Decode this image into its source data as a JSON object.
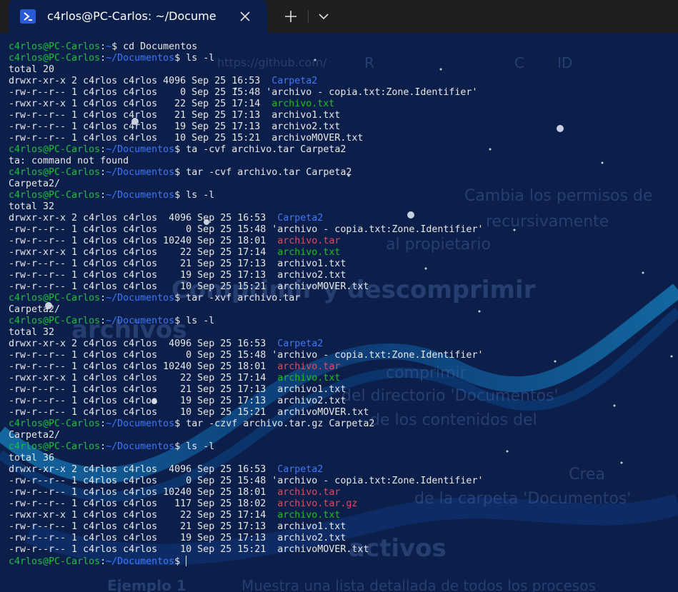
{
  "window": {
    "tab_title": "c4rlos@PC-Carlos: ~/Docume",
    "icons": {
      "tab": "powershell-icon",
      "close": "close-icon",
      "new_tab": "plus-icon",
      "dropdown": "chevron-down-icon"
    }
  },
  "colors": {
    "background": "#0c1f4a",
    "prompt_user": "#19c23a",
    "prompt_path": "#3b78ff",
    "directory": "#3b78ff",
    "archive": "#e74856",
    "executable": "#16c60c",
    "text": "#e8e8e8"
  },
  "background_text": [
    "https://github.com/",
    "R",
    "C",
    "ID",
    "Cambia los permisos de",
    "recursivamente",
    "al propietario",
    "Comprimir y descomprimir",
    "archivos",
    "comprimir",
    "del directorio 'Documentos'",
    "de los contenidos del",
    "Crea",
    "de la carpeta 'Documentos'",
    "activos",
    "Muestra una lista detallada de todos los procesos",
    "Ejemplo 1"
  ],
  "terminal": {
    "lines": [
      [
        {
          "t": "c4rlos@PC-Carlos",
          "c": "p-user"
        },
        {
          "t": ":",
          "c": "c-white"
        },
        {
          "t": "~",
          "c": "p-path"
        },
        {
          "t": "$ cd Documentos",
          "c": "c-white"
        }
      ],
      [
        {
          "t": "c4rlos@PC-Carlos",
          "c": "p-user"
        },
        {
          "t": ":",
          "c": "c-white"
        },
        {
          "t": "~/Documentos",
          "c": "p-path"
        },
        {
          "t": "$ ls -l",
          "c": "c-white"
        }
      ],
      [
        {
          "t": "total 20",
          "c": "c-white"
        }
      ],
      [
        {
          "t": "drwxr-xr-x 2 c4rlos c4rlos 4096 Sep 25 16:53  ",
          "c": "c-white"
        },
        {
          "t": "Carpeta2",
          "c": "c-dir"
        }
      ],
      [
        {
          "t": "-rw-r--r-- 1 c4rlos c4rlos    0 Sep 25 15:48 'archivo - copia.txt:Zone.Identifier'",
          "c": "c-white"
        }
      ],
      [
        {
          "t": "-rwxr-xr-x 1 c4rlos c4rlos   22 Sep 25 17:14  ",
          "c": "c-white"
        },
        {
          "t": "archivo.txt",
          "c": "c-green"
        }
      ],
      [
        {
          "t": "-rw-r--r-- 1 c4rlos c4rlos   21 Sep 25 17:13  archivo1.txt",
          "c": "c-white"
        }
      ],
      [
        {
          "t": "-rw-r--r-- 1 c4rlos c4rlos   19 Sep 25 17:13  archivo2.txt",
          "c": "c-white"
        }
      ],
      [
        {
          "t": "-rw-r--r-- 1 c4rlos c4rlos   10 Sep 25 15:21  archivoMOVER.txt",
          "c": "c-white"
        }
      ],
      [
        {
          "t": "c4rlos@PC-Carlos",
          "c": "p-user"
        },
        {
          "t": ":",
          "c": "c-white"
        },
        {
          "t": "~/Documentos",
          "c": "p-path"
        },
        {
          "t": "$ ta -cvf archivo.tar Carpeta2",
          "c": "c-white"
        }
      ],
      [
        {
          "t": "ta: command not found",
          "c": "c-white"
        }
      ],
      [
        {
          "t": "c4rlos@PC-Carlos",
          "c": "p-user"
        },
        {
          "t": ":",
          "c": "c-white"
        },
        {
          "t": "~/Documentos",
          "c": "p-path"
        },
        {
          "t": "$ tar -cvf archivo.tar Carpeta2",
          "c": "c-white"
        }
      ],
      [
        {
          "t": "Carpeta2/",
          "c": "c-white"
        }
      ],
      [
        {
          "t": "c4rlos@PC-Carlos",
          "c": "p-user"
        },
        {
          "t": ":",
          "c": "c-white"
        },
        {
          "t": "~/Documentos",
          "c": "p-path"
        },
        {
          "t": "$ ls -l",
          "c": "c-white"
        }
      ],
      [
        {
          "t": "total 32",
          "c": "c-white"
        }
      ],
      [
        {
          "t": "drwxr-xr-x 2 c4rlos c4rlos  4096 Sep 25 16:53  ",
          "c": "c-white"
        },
        {
          "t": "Carpeta2",
          "c": "c-dir"
        }
      ],
      [
        {
          "t": "-rw-r--r-- 1 c4rlos c4rlos     0 Sep 25 15:48 'archivo - copia.txt:Zone.Identifier'",
          "c": "c-white"
        }
      ],
      [
        {
          "t": "-rw-r--r-- 1 c4rlos c4rlos 10240 Sep 25 18:01  ",
          "c": "c-white"
        },
        {
          "t": "archivo.tar",
          "c": "c-red"
        }
      ],
      [
        {
          "t": "-rwxr-xr-x 1 c4rlos c4rlos    22 Sep 25 17:14  ",
          "c": "c-white"
        },
        {
          "t": "archivo.txt",
          "c": "c-green"
        }
      ],
      [
        {
          "t": "-rw-r--r-- 1 c4rlos c4rlos    21 Sep 25 17:13  archivo1.txt",
          "c": "c-white"
        }
      ],
      [
        {
          "t": "-rw-r--r-- 1 c4rlos c4rlos    19 Sep 25 17:13  archivo2.txt",
          "c": "c-white"
        }
      ],
      [
        {
          "t": "-rw-r--r-- 1 c4rlos c4rlos    10 Sep 25 15:21  archivoMOVER.txt",
          "c": "c-white"
        }
      ],
      [
        {
          "t": "c4rlos@PC-Carlos",
          "c": "p-user"
        },
        {
          "t": ":",
          "c": "c-white"
        },
        {
          "t": "~/Documentos",
          "c": "p-path"
        },
        {
          "t": "$ tar -xvf archivo.tar",
          "c": "c-white"
        }
      ],
      [
        {
          "t": "Carpeta2/",
          "c": "c-white"
        }
      ],
      [
        {
          "t": "c4rlos@PC-Carlos",
          "c": "p-user"
        },
        {
          "t": ":",
          "c": "c-white"
        },
        {
          "t": "~/Documentos",
          "c": "p-path"
        },
        {
          "t": "$ ls -l",
          "c": "c-white"
        }
      ],
      [
        {
          "t": "total 32",
          "c": "c-white"
        }
      ],
      [
        {
          "t": "drwxr-xr-x 2 c4rlos c4rlos  4096 Sep 25 16:53  ",
          "c": "c-white"
        },
        {
          "t": "Carpeta2",
          "c": "c-dir"
        }
      ],
      [
        {
          "t": "-rw-r--r-- 1 c4rlos c4rlos     0 Sep 25 15:48 'archivo - copia.txt:Zone.Identifier'",
          "c": "c-white"
        }
      ],
      [
        {
          "t": "-rw-r--r-- 1 c4rlos c4rlos 10240 Sep 25 18:01  ",
          "c": "c-white"
        },
        {
          "t": "archivo.tar",
          "c": "c-red"
        }
      ],
      [
        {
          "t": "-rwxr-xr-x 1 c4rlos c4rlos    22 Sep 25 17:14  ",
          "c": "c-white"
        },
        {
          "t": "archivo.txt",
          "c": "c-green"
        }
      ],
      [
        {
          "t": "-rw-r--r-- 1 c4rlos c4rlos    21 Sep 25 17:13  archivo1.txt",
          "c": "c-white"
        }
      ],
      [
        {
          "t": "-rw-r--r-- 1 c4rlos c4rlos    19 Sep 25 17:13  archivo2.txt",
          "c": "c-white"
        }
      ],
      [
        {
          "t": "-rw-r--r-- 1 c4rlos c4rlos    10 Sep 25 15:21  archivoMOVER.txt",
          "c": "c-white"
        }
      ],
      [
        {
          "t": "c4rlos@PC-Carlos",
          "c": "p-user"
        },
        {
          "t": ":",
          "c": "c-white"
        },
        {
          "t": "~/Documentos",
          "c": "p-path"
        },
        {
          "t": "$ tar -czvf archivo.tar.gz Carpeta2",
          "c": "c-white"
        }
      ],
      [
        {
          "t": "Carpeta2/",
          "c": "c-white"
        }
      ],
      [
        {
          "t": "c4rlos@PC-Carlos",
          "c": "p-user"
        },
        {
          "t": ":",
          "c": "c-white"
        },
        {
          "t": "~/Documentos",
          "c": "p-path"
        },
        {
          "t": "$ ls -l",
          "c": "c-white"
        }
      ],
      [
        {
          "t": "total 36",
          "c": "c-white"
        }
      ],
      [
        {
          "t": "drwxr-xr-x 2 c4rlos c4rlos  4096 Sep 25 16:53  ",
          "c": "c-white"
        },
        {
          "t": "Carpeta2",
          "c": "c-dir"
        }
      ],
      [
        {
          "t": "-rw-r--r-- 1 c4rlos c4rlos     0 Sep 25 15:48 'archivo - copia.txt:Zone.Identifier'",
          "c": "c-white"
        }
      ],
      [
        {
          "t": "-rw-r--r-- 1 c4rlos c4rlos 10240 Sep 25 18:01  ",
          "c": "c-white"
        },
        {
          "t": "archivo.tar",
          "c": "c-red"
        }
      ],
      [
        {
          "t": "-rw-r--r-- 1 c4rlos c4rlos   117 Sep 25 18:02  ",
          "c": "c-white"
        },
        {
          "t": "archivo.tar.gz",
          "c": "c-red"
        }
      ],
      [
        {
          "t": "-rwxr-xr-x 1 c4rlos c4rlos    22 Sep 25 17:14  ",
          "c": "c-white"
        },
        {
          "t": "archivo.txt",
          "c": "c-green"
        }
      ],
      [
        {
          "t": "-rw-r--r-- 1 c4rlos c4rlos    21 Sep 25 17:13  archivo1.txt",
          "c": "c-white"
        }
      ],
      [
        {
          "t": "-rw-r--r-- 1 c4rlos c4rlos    19 Sep 25 17:13  archivo2.txt",
          "c": "c-white"
        }
      ],
      [
        {
          "t": "-rw-r--r-- 1 c4rlos c4rlos    10 Sep 25 15:21  archivoMOVER.txt",
          "c": "c-white"
        }
      ],
      [
        {
          "t": "c4rlos@PC-Carlos",
          "c": "p-user"
        },
        {
          "t": ":",
          "c": "c-white"
        },
        {
          "t": "~/Documentos",
          "c": "p-path"
        },
        {
          "t": "$ ",
          "c": "c-white"
        }
      ]
    ]
  }
}
